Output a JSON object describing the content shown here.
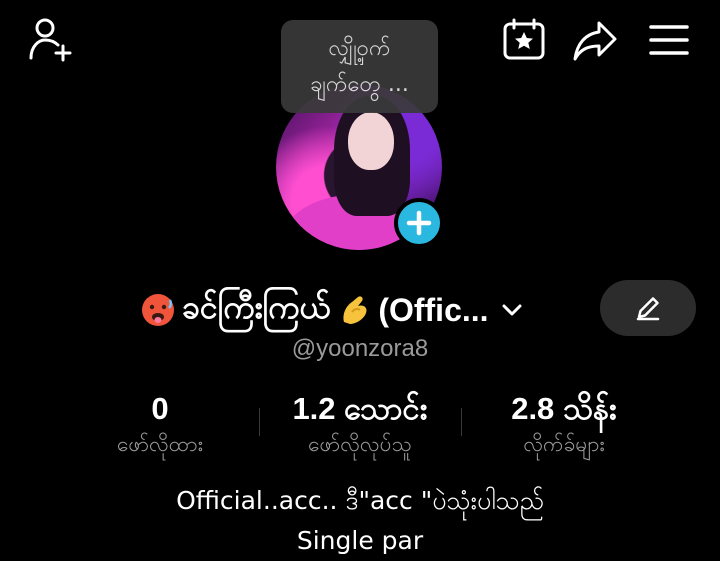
{
  "header": {
    "add_friend_icon": "person-add-icon",
    "calendar_icon": "calendar-star-icon",
    "share_icon": "share-arrow-icon",
    "menu_icon": "hamburger-menu-icon"
  },
  "tooltip": {
    "line1": "လျှို့ဝှက်",
    "line2": "ချက်တွေ ..."
  },
  "avatar": {
    "add_icon": "plus-icon",
    "accent": "#2ab7e0"
  },
  "profile": {
    "display_name": "ခင်ကြီးကြယ်",
    "display_name_suffix": "(Offic...",
    "username": "@yoonzora8"
  },
  "stats": [
    {
      "value": "0",
      "label": "ဖော်လိုထား"
    },
    {
      "value": "1.2 သောင်း",
      "label": "ဖော်လိုလုပ်သူ"
    },
    {
      "value": "2.8 သိန်း",
      "label": "လိုက်ခ်များ"
    }
  ],
  "bio": {
    "line1": "Official..acc.. ဒီ\"acc \"ပဲသုံးပါသည်",
    "line2": "Single par"
  }
}
